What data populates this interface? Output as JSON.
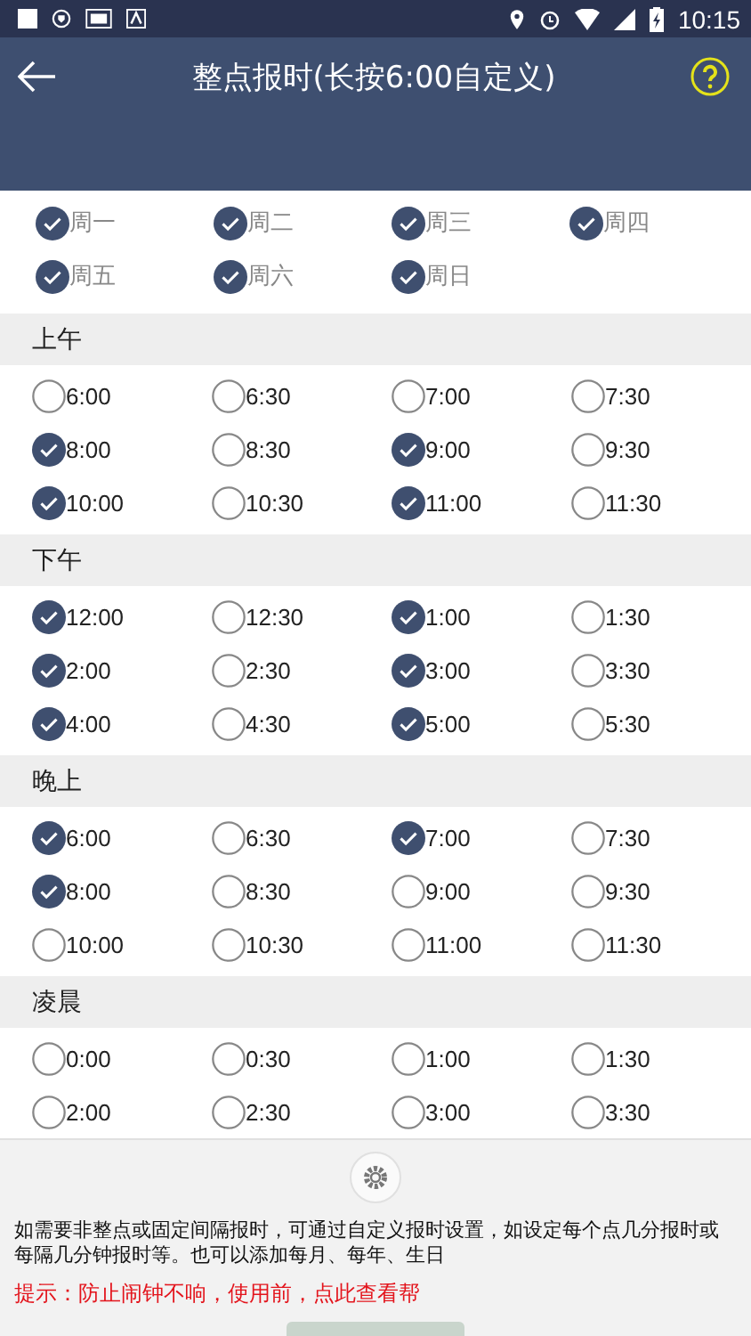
{
  "status_bar": {
    "time": "10:15"
  },
  "header": {
    "title": "整点报时(长按6:00自定义)"
  },
  "weekdays": [
    {
      "label": "周一",
      "checked": true
    },
    {
      "label": "周二",
      "checked": true
    },
    {
      "label": "周三",
      "checked": true
    },
    {
      "label": "周四",
      "checked": true
    },
    {
      "label": "周五",
      "checked": true
    },
    {
      "label": "周六",
      "checked": true
    },
    {
      "label": "周日",
      "checked": true
    }
  ],
  "sections": [
    {
      "title": "上午",
      "slots": [
        {
          "time": "6:00",
          "checked": false
        },
        {
          "time": "6:30",
          "checked": false
        },
        {
          "time": "7:00",
          "checked": false
        },
        {
          "time": "7:30",
          "checked": false
        },
        {
          "time": "8:00",
          "checked": true
        },
        {
          "time": "8:30",
          "checked": false
        },
        {
          "time": "9:00",
          "checked": true
        },
        {
          "time": "9:30",
          "checked": false
        },
        {
          "time": "10:00",
          "checked": true
        },
        {
          "time": "10:30",
          "checked": false
        },
        {
          "time": "11:00",
          "checked": true
        },
        {
          "time": "11:30",
          "checked": false
        }
      ]
    },
    {
      "title": "下午",
      "slots": [
        {
          "time": "12:00",
          "checked": true
        },
        {
          "time": "12:30",
          "checked": false
        },
        {
          "time": "1:00",
          "checked": true
        },
        {
          "time": "1:30",
          "checked": false
        },
        {
          "time": "2:00",
          "checked": true
        },
        {
          "time": "2:30",
          "checked": false
        },
        {
          "time": "3:00",
          "checked": true
        },
        {
          "time": "3:30",
          "checked": false
        },
        {
          "time": "4:00",
          "checked": true
        },
        {
          "time": "4:30",
          "checked": false
        },
        {
          "time": "5:00",
          "checked": true
        },
        {
          "time": "5:30",
          "checked": false
        }
      ]
    },
    {
      "title": "晚上",
      "slots": [
        {
          "time": "6:00",
          "checked": true
        },
        {
          "time": "6:30",
          "checked": false
        },
        {
          "time": "7:00",
          "checked": true
        },
        {
          "time": "7:30",
          "checked": false
        },
        {
          "time": "8:00",
          "checked": true
        },
        {
          "time": "8:30",
          "checked": false
        },
        {
          "time": "9:00",
          "checked": false
        },
        {
          "time": "9:30",
          "checked": false
        },
        {
          "time": "10:00",
          "checked": false
        },
        {
          "time": "10:30",
          "checked": false
        },
        {
          "time": "11:00",
          "checked": false
        },
        {
          "time": "11:30",
          "checked": false
        }
      ]
    },
    {
      "title": "凌晨",
      "slots": [
        {
          "time": "0:00",
          "checked": false
        },
        {
          "time": "0:30",
          "checked": false
        },
        {
          "time": "1:00",
          "checked": false
        },
        {
          "time": "1:30",
          "checked": false
        },
        {
          "time": "2:00",
          "checked": false
        },
        {
          "time": "2:30",
          "checked": false
        },
        {
          "time": "3:00",
          "checked": false
        },
        {
          "time": "3:30",
          "checked": false
        }
      ]
    }
  ],
  "footer": {
    "description": "如需要非整点或固定间隔报时，可通过自定义报时设置，如设定每个点几分报时或每隔几分钟报时等。也可以添加每月、每年、生日",
    "tip": "提示：防止闹钟不响，使用前，点此查看帮"
  }
}
